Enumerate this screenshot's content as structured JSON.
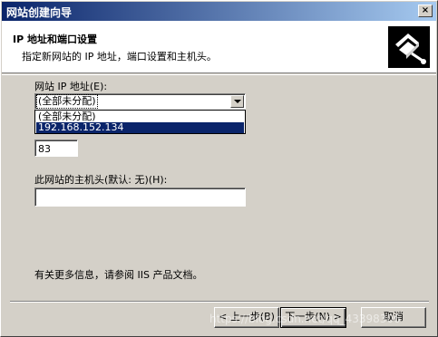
{
  "window": {
    "title": "网站创建向导",
    "close_label": "×"
  },
  "header": {
    "title": "IP 地址和端口设置",
    "subtitle": "指定新网站的 IP 地址，端口设置和主机头。",
    "icon": "wizard-book-icon"
  },
  "ip": {
    "label": "网站 IP 地址(E):",
    "selected": "(全部未分配)",
    "options": [
      "(全部未分配)",
      "192.168.152.134"
    ]
  },
  "port": {
    "value": "83"
  },
  "host": {
    "label": "此网站的主机头(默认: 无)(H):",
    "value": ""
  },
  "info": "有关更多信息，请参阅 IIS 产品文档。",
  "buttons": {
    "back": "< 上一步(B)",
    "next": "下一步(N) >",
    "cancel": "取消"
  },
  "watermark": "https://blog.csdn.net/qq_43398306"
}
